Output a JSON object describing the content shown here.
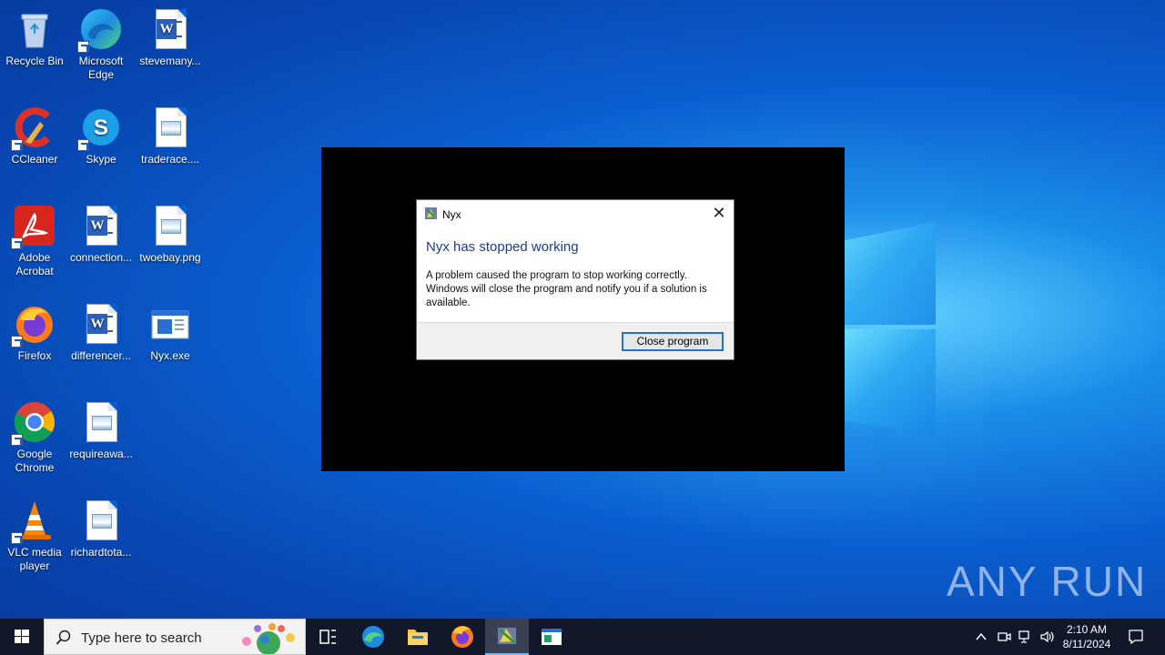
{
  "desktop": {
    "icons": [
      {
        "label": "Recycle Bin"
      },
      {
        "label": "Microsoft Edge"
      },
      {
        "label": "stevemany..."
      },
      {
        "label": "CCleaner"
      },
      {
        "label": "Skype"
      },
      {
        "label": "traderace...."
      },
      {
        "label": "Adobe Acrobat"
      },
      {
        "label": "connection..."
      },
      {
        "label": "twoebay.png"
      },
      {
        "label": "Firefox"
      },
      {
        "label": "differencer..."
      },
      {
        "label": "Nyx.exe"
      },
      {
        "label": "Google Chrome"
      },
      {
        "label": "requireawa..."
      },
      {
        "label": "VLC media player"
      },
      {
        "label": "richardtota..."
      }
    ]
  },
  "dialog": {
    "title": "Nyx",
    "heading": "Nyx has stopped working",
    "body": "A problem caused the program to stop working correctly. Windows will close the program and notify you if a solution is available.",
    "button_label": "Close program",
    "close_glyph": "✕"
  },
  "watermark": {
    "text": "ANY RUN"
  },
  "taskbar": {
    "search_placeholder": "Type here to search",
    "clock_time": "2:10 AM",
    "clock_date": "8/11/2024"
  },
  "colors": {
    "accent": "#2a6ed2",
    "heading": "#1c3c8e",
    "taskbar": "#11182a"
  }
}
